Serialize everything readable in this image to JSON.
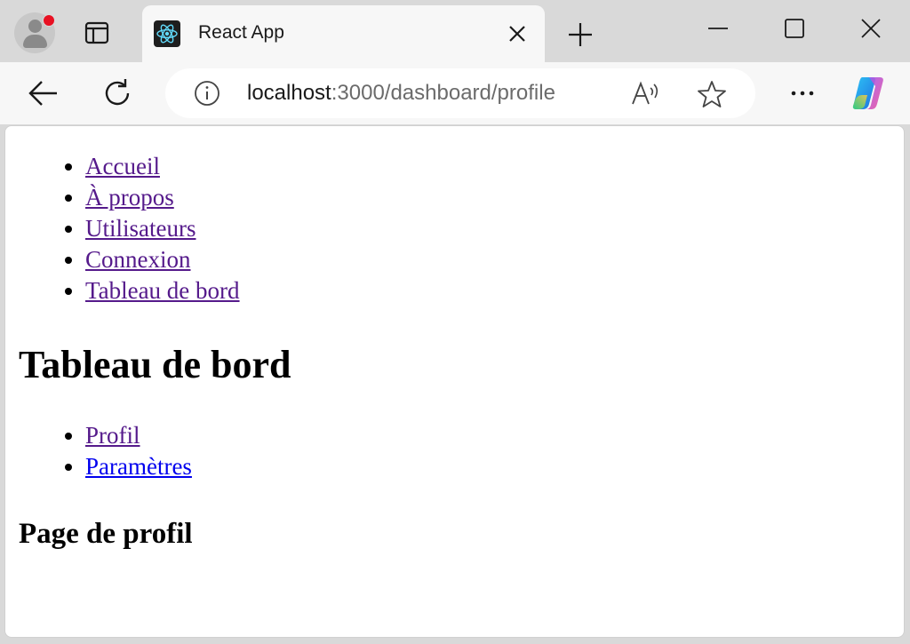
{
  "browser": {
    "tab": {
      "title": "React App",
      "favicon": "react-logo-icon"
    },
    "address_bar": {
      "host": "localhost",
      "path": ":3000/dashboard/profile"
    },
    "icons": {
      "profile": "profile-avatar-icon",
      "tabs_view": "tab-actions-icon",
      "new_tab": "plus-icon",
      "back": "arrow-left-icon",
      "reload": "reload-icon",
      "info": "info-icon",
      "read_aloud": "read-aloud-icon",
      "favorite": "star-icon",
      "more": "more-icon",
      "copilot": "copilot-icon"
    },
    "colors": {
      "chrome": "#d9d9d9",
      "toolbar": "#f7f7f7",
      "link_visited": "#551a8b",
      "link": "#0000ee",
      "notification_dot": "#e81123"
    }
  },
  "page": {
    "nav": [
      {
        "label": "Accueil"
      },
      {
        "label": "À propos"
      },
      {
        "label": "Utilisateurs"
      },
      {
        "label": "Connexion"
      },
      {
        "label": "Tableau de bord"
      }
    ],
    "heading": "Tableau de bord",
    "subnav": [
      {
        "label": "Profil"
      },
      {
        "label": "Paramètres"
      }
    ],
    "section_heading": "Page de profil"
  }
}
